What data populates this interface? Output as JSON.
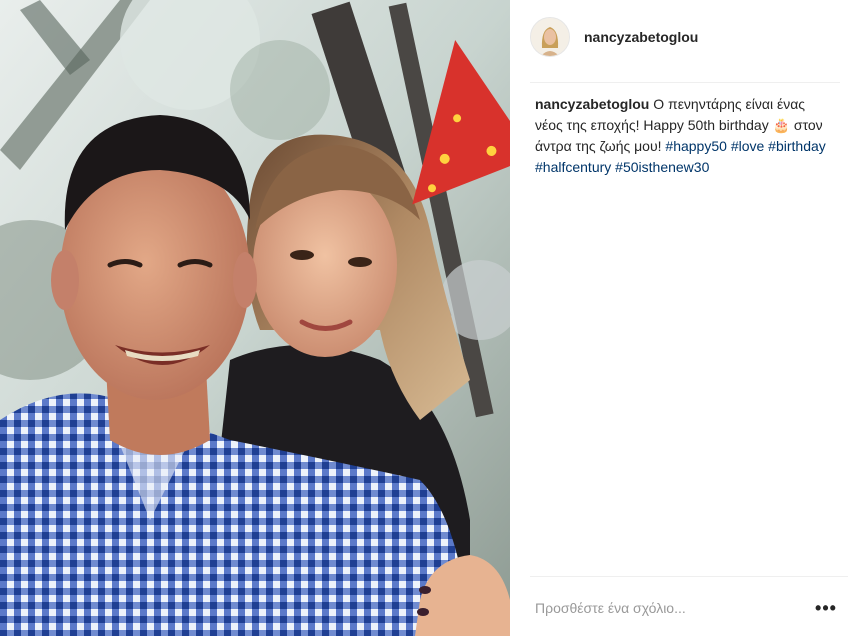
{
  "post": {
    "username": "nancyzabetoglou",
    "avatar_icon": "profile-avatar",
    "caption": {
      "user": "nancyzabetoglou",
      "text_1": "Ο πενηντάρης είναι ένας νέος της εποχής! Happy 50th birthday",
      "emoji": "🎂",
      "text_2": "στον άντρα της ζωής μου!",
      "hashtags": [
        "#happy50",
        "#love",
        "#birthday",
        "#halfcentury",
        "#50isthenew30"
      ]
    },
    "comment": {
      "placeholder": "Προσθέστε ένα σχόλιο...",
      "more_icon": "more-options-icon",
      "more_label": "•••"
    }
  },
  "colors": {
    "hashtag": "#003569",
    "text": "#262626",
    "placeholder": "#999999",
    "divider": "#efefef",
    "party_hat": "#d8322c"
  }
}
